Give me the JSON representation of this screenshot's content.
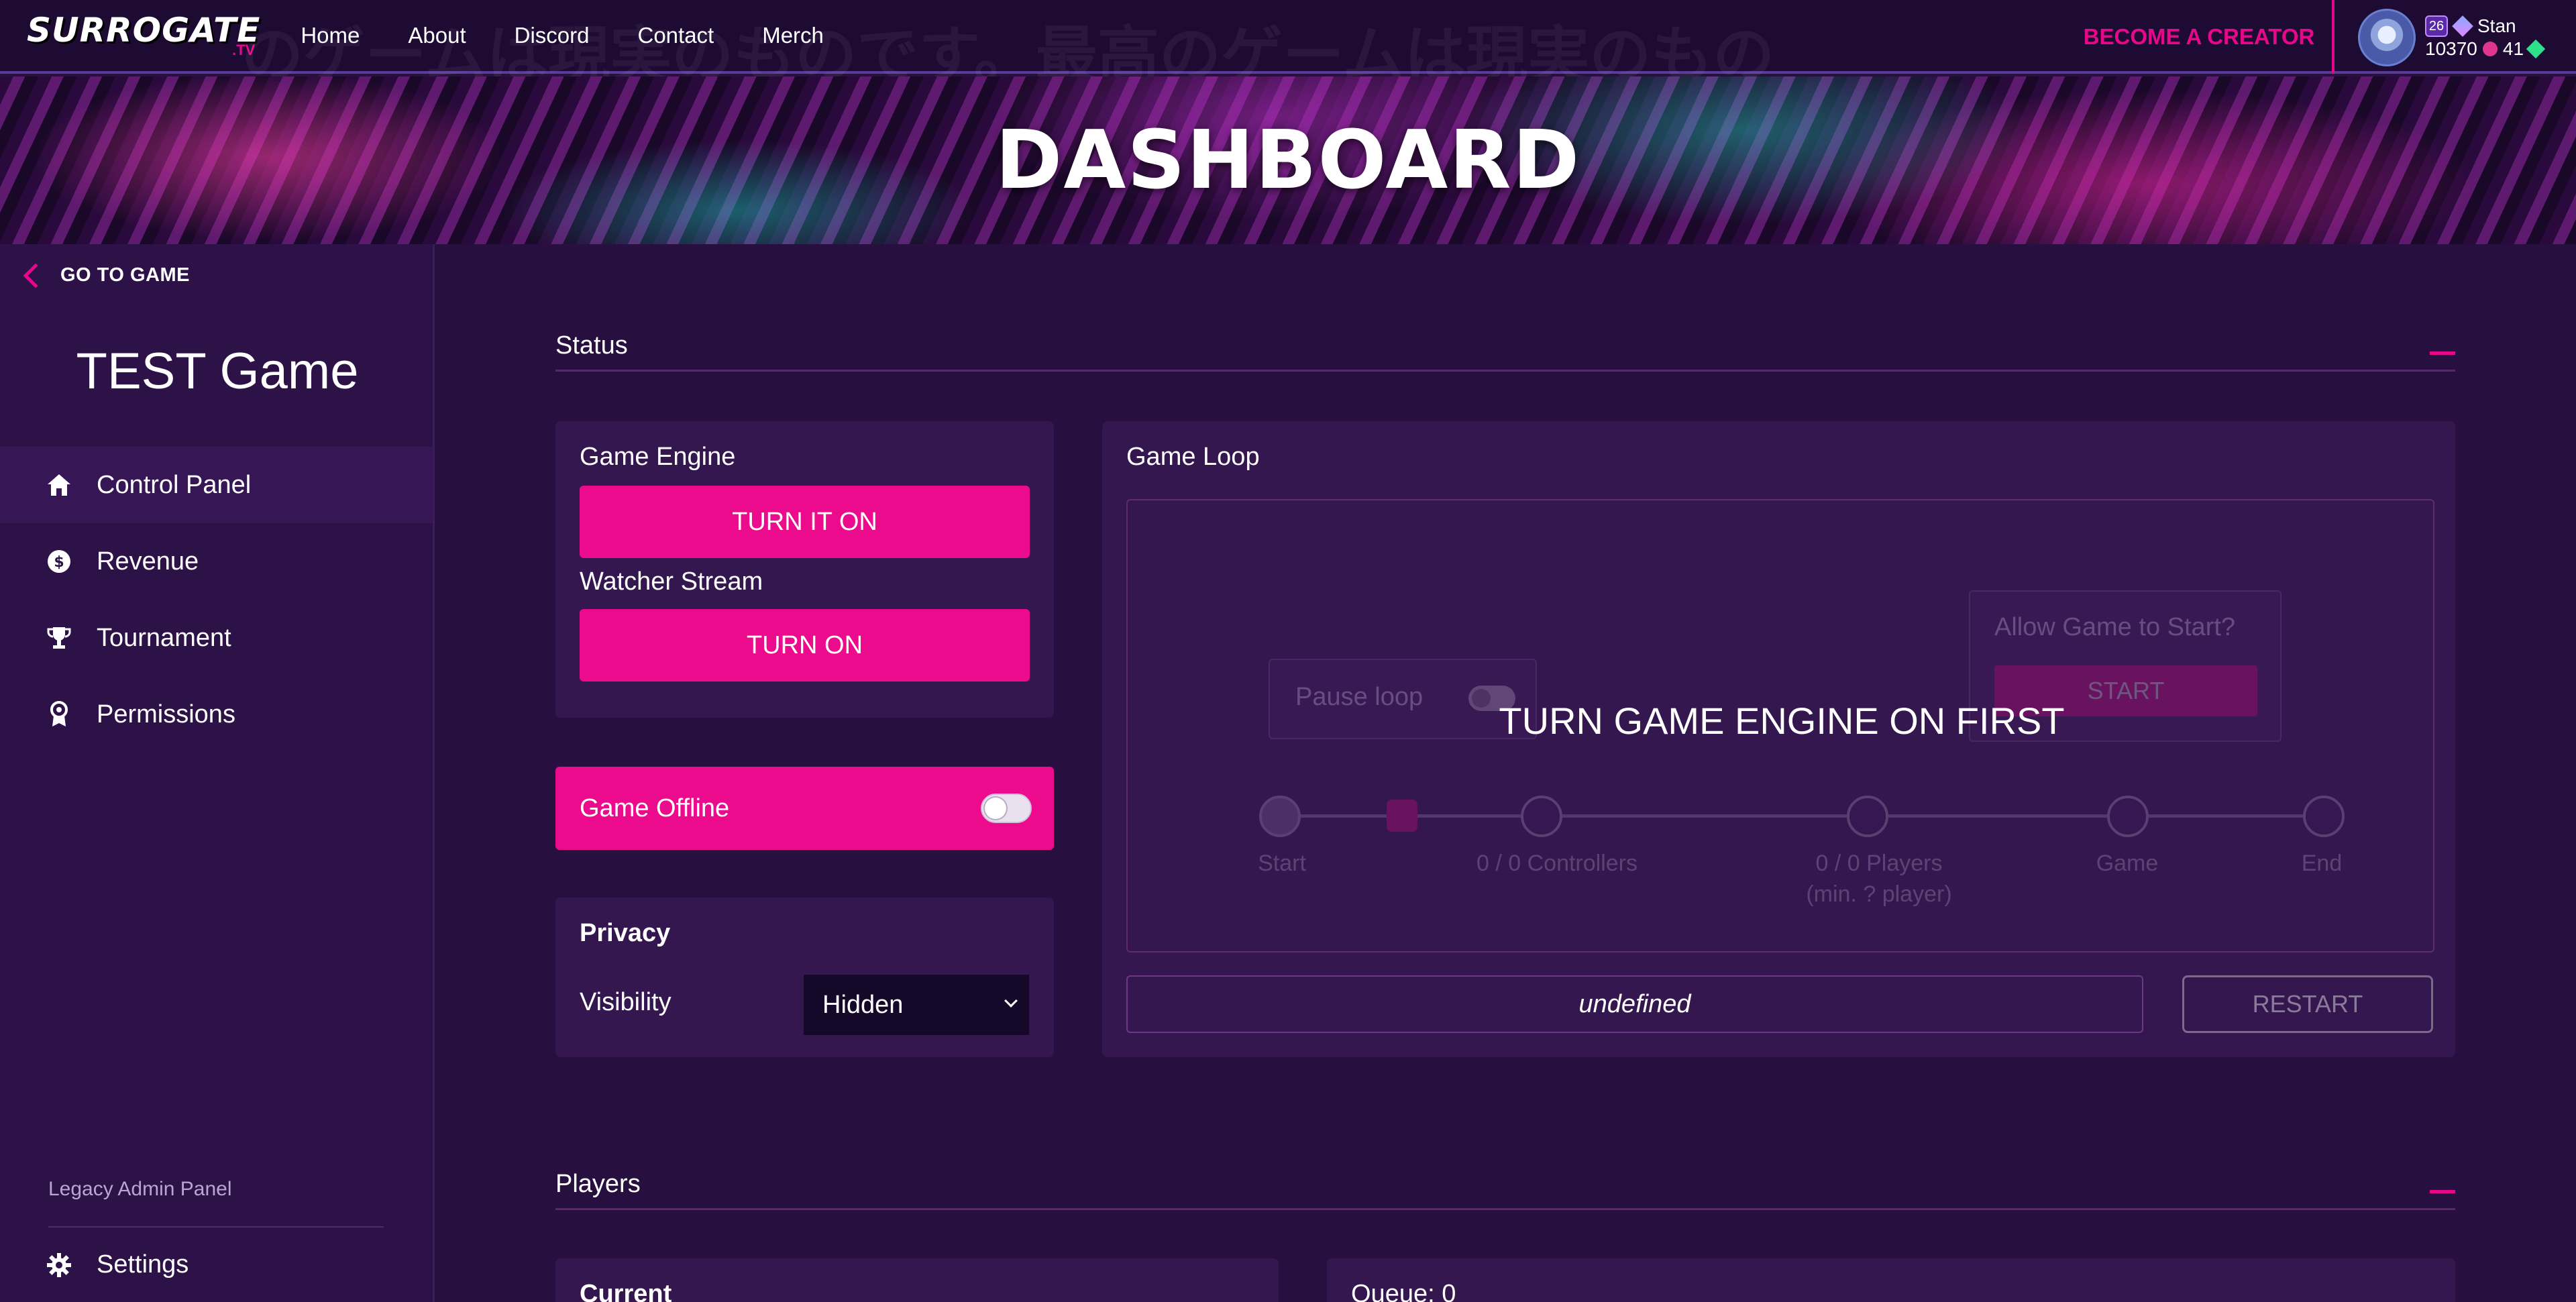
{
  "nav": {
    "logo_main": "SURROGATE",
    "logo_tv": ".TV",
    "watermark": "のゲームは現実のものです。最高のゲームは現実のもの",
    "links": [
      "Home",
      "About",
      "Discord",
      "Contact",
      "Merch"
    ],
    "creator_label": "BECOME A CREATOR",
    "user": {
      "name": "Stan",
      "level": "26",
      "coins": "10370",
      "gems": "41"
    }
  },
  "banner": {
    "title": "DASHBOARD"
  },
  "sidebar": {
    "back_label": "GO TO GAME",
    "game_name": "TEST Game",
    "items": [
      {
        "label": "Control Panel",
        "icon": "home-icon"
      },
      {
        "label": "Revenue",
        "icon": "dollar-icon"
      },
      {
        "label": "Tournament",
        "icon": "trophy-icon"
      },
      {
        "label": "Permissions",
        "icon": "badge-icon"
      }
    ],
    "legacy_label": "Legacy Admin Panel",
    "settings_label": "Settings"
  },
  "status": {
    "title": "Status",
    "engine_label": "Game Engine",
    "engine_button": "TURN IT ON",
    "stream_label": "Watcher Stream",
    "stream_button": "TURN ON",
    "offline_label": "Game Offline",
    "privacy_title": "Privacy",
    "visibility_label": "Visibility",
    "visibility_value": "Hidden"
  },
  "loop": {
    "title": "Game Loop",
    "pause_label": "Pause loop",
    "allow_label": "Allow Game to Start?",
    "start_button": "START",
    "overlay": "TURN GAME ENGINE ON FIRST",
    "steps": {
      "start": "Start",
      "controllers": "0 / 0 Controllers",
      "players": "0 / 0 Players",
      "players_min": "(min. ? player)",
      "game": "Game",
      "end": "End"
    },
    "status_value": "undefined",
    "restart_button": "RESTART"
  },
  "players": {
    "title": "Players",
    "current_label": "Current",
    "queue_label": "Queue: 0"
  },
  "colors": {
    "accent": "#ec0a8d",
    "background": "#27103f",
    "card": "#35174f"
  }
}
